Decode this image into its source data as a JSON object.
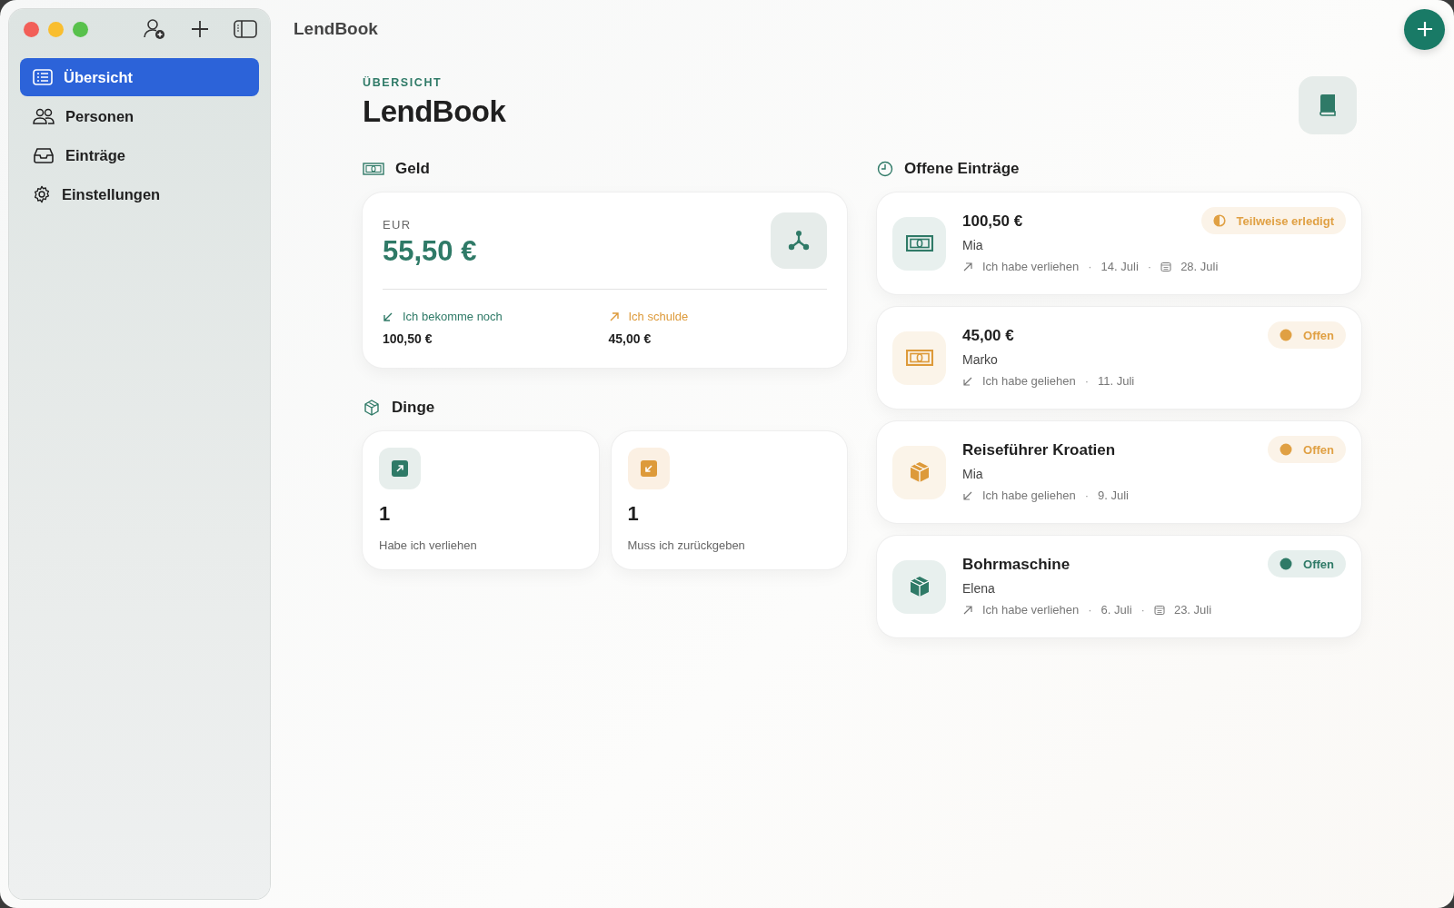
{
  "window": {
    "title": "LendBook"
  },
  "sidebar": {
    "items": [
      {
        "label": "Übersicht",
        "selected": true
      },
      {
        "label": "Personen",
        "selected": false
      },
      {
        "label": "Einträge",
        "selected": false
      },
      {
        "label": "Einstellungen",
        "selected": false
      }
    ]
  },
  "header": {
    "eyebrow": "ÜBERSICHT",
    "title": "LendBook"
  },
  "money": {
    "heading": "Geld",
    "currency": "EUR",
    "total": "55,50 €",
    "receive": {
      "label": "Ich bekomme noch",
      "amount": "100,50 €"
    },
    "owe": {
      "label": "Ich schulde",
      "amount": "45,00 €"
    }
  },
  "things": {
    "heading": "Dinge",
    "cards": [
      {
        "kind": "lent",
        "count": "1",
        "label": "Habe ich verliehen"
      },
      {
        "kind": "borrowed",
        "count": "1",
        "label": "Muss ich zurückgeben"
      }
    ]
  },
  "open_entries": {
    "heading": "Offene Einträge",
    "items": [
      {
        "kind": "money",
        "color": "#2f7a67",
        "title": "100,50 €",
        "person": "Mia",
        "status": {
          "kind": "partial",
          "label": "Teilweise erledigt",
          "color": "#e0a043"
        },
        "meta": [
          {
            "kind": "lent",
            "text": "Ich habe verliehen"
          },
          {
            "kind": "separator",
            "text": "·"
          },
          {
            "kind": "date",
            "text": "14. Juli"
          },
          {
            "kind": "separator",
            "text": "·"
          },
          {
            "kind": "due",
            "text": "28. Juli"
          }
        ]
      },
      {
        "kind": "money",
        "color": "#dd9a3a",
        "title": "45,00 €",
        "person": "Marko",
        "status": {
          "kind": "open",
          "label": "Offen",
          "color": "#e0a043"
        },
        "meta": [
          {
            "kind": "borrowed",
            "text": "Ich habe geliehen"
          },
          {
            "kind": "separator",
            "text": "·"
          },
          {
            "kind": "date",
            "text": "11. Juli"
          }
        ]
      },
      {
        "kind": "thing",
        "color": "#dd9a3a",
        "title": "Reiseführer Kroatien",
        "person": "Mia",
        "status": {
          "kind": "open",
          "label": "Offen",
          "color": "#e0a043"
        },
        "meta": [
          {
            "kind": "borrowed",
            "text": "Ich habe geliehen"
          },
          {
            "kind": "separator",
            "text": "·"
          },
          {
            "kind": "date",
            "text": "9. Juli"
          }
        ]
      },
      {
        "kind": "thing",
        "color": "#2f7a67",
        "title": "Bohrmaschine",
        "person": "Elena",
        "status": {
          "kind": "open",
          "label": "Offen",
          "color": "#2f7a67"
        },
        "meta": [
          {
            "kind": "lent",
            "text": "Ich habe verliehen"
          },
          {
            "kind": "separator",
            "text": "·"
          },
          {
            "kind": "date",
            "text": "6. Juli"
          },
          {
            "kind": "separator",
            "text": "·"
          },
          {
            "kind": "due",
            "text": "23. Juli"
          }
        ]
      }
    ]
  }
}
